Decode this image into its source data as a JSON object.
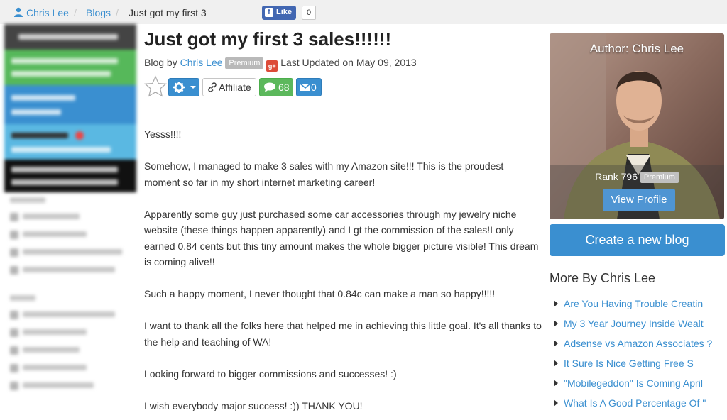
{
  "breadcrumb": {
    "user": "Chris Lee",
    "blogs": "Blogs",
    "current": "Just got my first 3",
    "separator": "/"
  },
  "facebook": {
    "like_label": "Like",
    "like_count": "0"
  },
  "post": {
    "title": "Just got my first 3 sales!!!!!!",
    "blog_by": "Blog by",
    "author": "Chris Lee",
    "author_badge": "Premium",
    "google_plus_icon": "g+",
    "last_updated": "Last Updated on May 09, 2013",
    "affiliate_label": "Affiliate",
    "comments_count": "68",
    "messages_count": "0",
    "paragraphs": [
      "Yesss!!!!",
      "Somehow, I managed to make 3 sales with my Amazon site!!! This is the proudest moment so far in my short internet marketing career!",
      "Apparently some guy just purchased some car accessories through my jewelry niche website (these things happen apparently) and I gt the commission of the sales!I only earned 0.84 cents but this tiny amount makes the whole bigger picture visible! This dream is coming alive!!",
      "Such a happy moment, I never thought that 0.84c can make a man so happy!!!!!",
      "I want to thank all the folks here that helped me in achieving this little goal. It's all thanks to the help and teaching of WA!",
      "Looking forward to bigger commissions and successes! :)",
      "I wish everybody major success! :)) THANK YOU!"
    ]
  },
  "author_card": {
    "title": "Author: Chris Lee",
    "rank_label": "Rank 796",
    "rank_badge": "Premium",
    "view_profile": "View Profile"
  },
  "create_blog": "Create a new blog",
  "more_by": {
    "title": "More By Chris Lee",
    "items": [
      "Are You Having Trouble Creatin",
      "My 3 Year Journey Inside Wealt",
      "Adsense vs Amazon Associates ?",
      "It Sure Is Nice Getting Free S",
      "\"Mobilegeddon\" Is Coming April",
      "What Is A Good Percentage Of \""
    ]
  },
  "colors": {
    "link": "#3a8fd0",
    "primary_button": "#3a8fd0",
    "comments_button": "#5cb85c",
    "badge": "#b9b9b9"
  }
}
